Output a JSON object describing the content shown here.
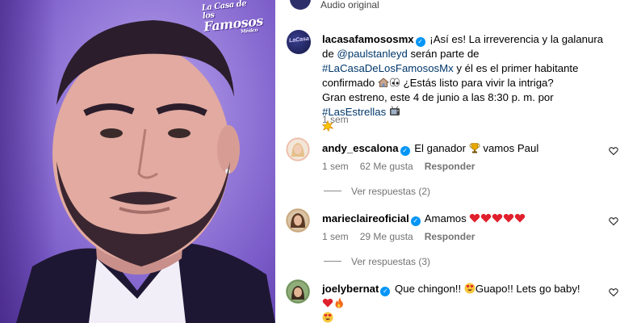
{
  "audio": {
    "label": "Audio original"
  },
  "brand": {
    "line1": "La Casa de los",
    "line2": "Famosos",
    "line3": "México"
  },
  "post": {
    "avatar_text": "LaCasa",
    "username": "lacasafamososmx",
    "caption_1": " ¡Así es! La irreverencia y la galanura de ",
    "mention": "@paulstanleyd",
    "caption_2": " serán parte de ",
    "hashtag1": "#LaCasaDeLosFamososMx",
    "caption_3": " y él es el primer habitante confirmado ",
    "caption_4": " ¿Estás listo para vivir la intriga?",
    "caption_5": "Gran estreno, este 4 de junio a las 8:30 p. m. por ",
    "hashtag2": "#LasEstrellas",
    "time": "1 sem"
  },
  "comments": [
    {
      "username": "andy_escalona",
      "text_a": " El ganador ",
      "text_b": " vamos Paul",
      "time": "1 sem",
      "likes": "62 Me gusta",
      "reply": "Responder",
      "view_replies": "Ver respuestas (2)"
    },
    {
      "username": "marieclaireoficial",
      "text_a": " Amamos ",
      "time": "1 sem",
      "likes": "29 Me gusta",
      "reply": "Responder",
      "view_replies": "Ver respuestas (3)"
    },
    {
      "username": "joelybernat",
      "text_a": " Que chingon!! ",
      "text_b": "Guapo!! Lets go baby! ",
      "time": "1 sem"
    }
  ],
  "colors": {
    "link": "#00376b",
    "verified": "#0095f6",
    "heart": "#e0202c",
    "muted": "#737373"
  }
}
